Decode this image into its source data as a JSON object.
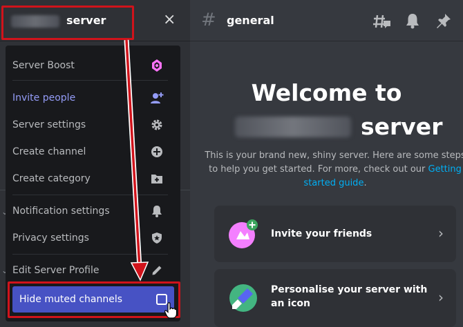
{
  "server": {
    "name_suffix": "server",
    "close_glyph": "×"
  },
  "menu": {
    "items": [
      {
        "label": "Server Boost",
        "icon": "boost-gem-icon"
      },
      {
        "label": "Invite people",
        "icon": "add-user-icon"
      },
      {
        "label": "Server settings",
        "icon": "gear-icon"
      },
      {
        "label": "Create channel",
        "icon": "plus-circle-icon"
      },
      {
        "label": "Create category",
        "icon": "folder-plus-icon"
      },
      {
        "label": "Notification settings",
        "icon": "bell-icon"
      },
      {
        "label": "Privacy settings",
        "icon": "shield-star-icon"
      },
      {
        "label": "Edit Server Profile",
        "icon": "pencil-icon"
      }
    ],
    "hide_muted": {
      "label": "Hide muted channels",
      "checked": false
    }
  },
  "topbar": {
    "hash_glyph": "#",
    "channel": "general",
    "icons": [
      "threads-icon",
      "bell-icon",
      "pin-icon"
    ]
  },
  "welcome": {
    "title_line1": "Welcome to",
    "title_line2_suffix": "server",
    "description": "This is your brand new, shiny server. Here are some steps to help you get started. For more, check out our",
    "link": "Getting started guide",
    "link_trailer": "."
  },
  "cards": [
    {
      "label": "Invite your friends",
      "icon": "invite-friends-icon"
    },
    {
      "label": "Personalise your server with an icon",
      "icon": "paintbrush-icon"
    }
  ],
  "colors": {
    "accent": "#5865f2",
    "hover": "#4752c4",
    "annotation": "#d0131b",
    "link": "#00aff4",
    "boost": "#ff73fa"
  }
}
